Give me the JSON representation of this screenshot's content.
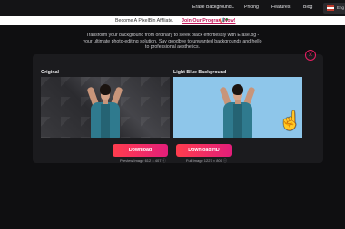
{
  "nav": {
    "items": [
      "Erase Background",
      "Pricing",
      "Features",
      "Blog"
    ],
    "caret": "⌄",
    "language": "Eng"
  },
  "banner": {
    "text": "Become A PixelBin Affiliate.",
    "link": "Join Our Program Now!",
    "icons": [
      "megaphone-icon",
      "dollar-icon"
    ]
  },
  "intro": "Transform your background from ordinary to sleek black effortlessly with Erase.bg - your ultimate photo-editing solution. Say goodbye to unwanted backgrounds and hello to professional aesthetics.",
  "panel": {
    "close_symbol": "×",
    "original_label": "Original",
    "result_label": "Light Blue Background",
    "download_label": "Download",
    "download_hd_label": "Download HD",
    "preview_caption": "Preview Image 612 × 407",
    "full_caption": "Full Image 1227 × 800",
    "info_symbol": "ⓘ"
  },
  "colors": {
    "accent_start": "#ff3d4d",
    "accent_end": "#e31e7a",
    "result_background": "#8ec6ea",
    "link": "#c2185b"
  }
}
